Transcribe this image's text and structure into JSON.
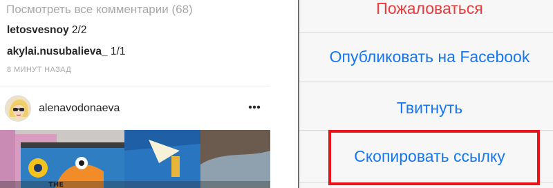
{
  "feed": {
    "view_all_comments": "Посмотреть все комментарии (68)",
    "comments": [
      {
        "user": "letosvesnoy",
        "text": "2/2"
      },
      {
        "user": "akylai.nusubalieva_",
        "text": "1/1"
      }
    ],
    "timestamp": "8 МИНУТ НАЗАД",
    "next_post": {
      "author": "alenavodonaeva",
      "avatar_icon": "avatar-icon",
      "menu_icon": "more-horizontal-icon"
    }
  },
  "share_sheet": {
    "report": "Пожаловаться",
    "share_facebook": "Опубликовать на Facebook",
    "tweet": "Твитнуть",
    "copy_link": "Скопировать ссылку"
  },
  "colors": {
    "action_blue": "#1777f2",
    "report_red": "#ea3b3b",
    "highlight_red": "#e8141b",
    "muted_text": "#a8a8a8"
  }
}
